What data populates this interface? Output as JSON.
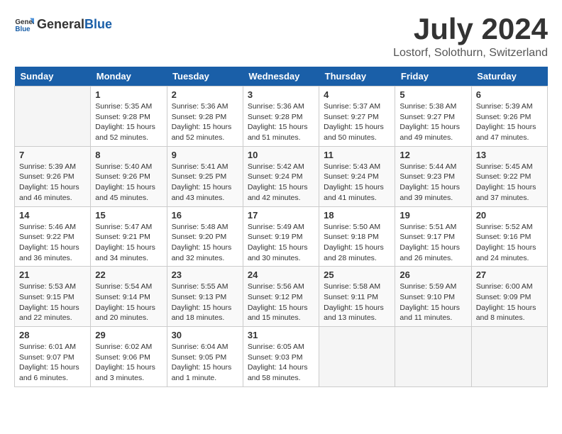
{
  "header": {
    "logo_general": "General",
    "logo_blue": "Blue",
    "month_title": "July 2024",
    "location": "Lostorf, Solothurn, Switzerland"
  },
  "weekdays": [
    "Sunday",
    "Monday",
    "Tuesday",
    "Wednesday",
    "Thursday",
    "Friday",
    "Saturday"
  ],
  "weeks": [
    [
      {
        "day": "",
        "sunrise": "",
        "sunset": "",
        "daylight": ""
      },
      {
        "day": "1",
        "sunrise": "Sunrise: 5:35 AM",
        "sunset": "Sunset: 9:28 PM",
        "daylight": "Daylight: 15 hours and 52 minutes."
      },
      {
        "day": "2",
        "sunrise": "Sunrise: 5:36 AM",
        "sunset": "Sunset: 9:28 PM",
        "daylight": "Daylight: 15 hours and 52 minutes."
      },
      {
        "day": "3",
        "sunrise": "Sunrise: 5:36 AM",
        "sunset": "Sunset: 9:28 PM",
        "daylight": "Daylight: 15 hours and 51 minutes."
      },
      {
        "day": "4",
        "sunrise": "Sunrise: 5:37 AM",
        "sunset": "Sunset: 9:27 PM",
        "daylight": "Daylight: 15 hours and 50 minutes."
      },
      {
        "day": "5",
        "sunrise": "Sunrise: 5:38 AM",
        "sunset": "Sunset: 9:27 PM",
        "daylight": "Daylight: 15 hours and 49 minutes."
      },
      {
        "day": "6",
        "sunrise": "Sunrise: 5:39 AM",
        "sunset": "Sunset: 9:26 PM",
        "daylight": "Daylight: 15 hours and 47 minutes."
      }
    ],
    [
      {
        "day": "7",
        "sunrise": "Sunrise: 5:39 AM",
        "sunset": "Sunset: 9:26 PM",
        "daylight": "Daylight: 15 hours and 46 minutes."
      },
      {
        "day": "8",
        "sunrise": "Sunrise: 5:40 AM",
        "sunset": "Sunset: 9:26 PM",
        "daylight": "Daylight: 15 hours and 45 minutes."
      },
      {
        "day": "9",
        "sunrise": "Sunrise: 5:41 AM",
        "sunset": "Sunset: 9:25 PM",
        "daylight": "Daylight: 15 hours and 43 minutes."
      },
      {
        "day": "10",
        "sunrise": "Sunrise: 5:42 AM",
        "sunset": "Sunset: 9:24 PM",
        "daylight": "Daylight: 15 hours and 42 minutes."
      },
      {
        "day": "11",
        "sunrise": "Sunrise: 5:43 AM",
        "sunset": "Sunset: 9:24 PM",
        "daylight": "Daylight: 15 hours and 41 minutes."
      },
      {
        "day": "12",
        "sunrise": "Sunrise: 5:44 AM",
        "sunset": "Sunset: 9:23 PM",
        "daylight": "Daylight: 15 hours and 39 minutes."
      },
      {
        "day": "13",
        "sunrise": "Sunrise: 5:45 AM",
        "sunset": "Sunset: 9:22 PM",
        "daylight": "Daylight: 15 hours and 37 minutes."
      }
    ],
    [
      {
        "day": "14",
        "sunrise": "Sunrise: 5:46 AM",
        "sunset": "Sunset: 9:22 PM",
        "daylight": "Daylight: 15 hours and 36 minutes."
      },
      {
        "day": "15",
        "sunrise": "Sunrise: 5:47 AM",
        "sunset": "Sunset: 9:21 PM",
        "daylight": "Daylight: 15 hours and 34 minutes."
      },
      {
        "day": "16",
        "sunrise": "Sunrise: 5:48 AM",
        "sunset": "Sunset: 9:20 PM",
        "daylight": "Daylight: 15 hours and 32 minutes."
      },
      {
        "day": "17",
        "sunrise": "Sunrise: 5:49 AM",
        "sunset": "Sunset: 9:19 PM",
        "daylight": "Daylight: 15 hours and 30 minutes."
      },
      {
        "day": "18",
        "sunrise": "Sunrise: 5:50 AM",
        "sunset": "Sunset: 9:18 PM",
        "daylight": "Daylight: 15 hours and 28 minutes."
      },
      {
        "day": "19",
        "sunrise": "Sunrise: 5:51 AM",
        "sunset": "Sunset: 9:17 PM",
        "daylight": "Daylight: 15 hours and 26 minutes."
      },
      {
        "day": "20",
        "sunrise": "Sunrise: 5:52 AM",
        "sunset": "Sunset: 9:16 PM",
        "daylight": "Daylight: 15 hours and 24 minutes."
      }
    ],
    [
      {
        "day": "21",
        "sunrise": "Sunrise: 5:53 AM",
        "sunset": "Sunset: 9:15 PM",
        "daylight": "Daylight: 15 hours and 22 minutes."
      },
      {
        "day": "22",
        "sunrise": "Sunrise: 5:54 AM",
        "sunset": "Sunset: 9:14 PM",
        "daylight": "Daylight: 15 hours and 20 minutes."
      },
      {
        "day": "23",
        "sunrise": "Sunrise: 5:55 AM",
        "sunset": "Sunset: 9:13 PM",
        "daylight": "Daylight: 15 hours and 18 minutes."
      },
      {
        "day": "24",
        "sunrise": "Sunrise: 5:56 AM",
        "sunset": "Sunset: 9:12 PM",
        "daylight": "Daylight: 15 hours and 15 minutes."
      },
      {
        "day": "25",
        "sunrise": "Sunrise: 5:58 AM",
        "sunset": "Sunset: 9:11 PM",
        "daylight": "Daylight: 15 hours and 13 minutes."
      },
      {
        "day": "26",
        "sunrise": "Sunrise: 5:59 AM",
        "sunset": "Sunset: 9:10 PM",
        "daylight": "Daylight: 15 hours and 11 minutes."
      },
      {
        "day": "27",
        "sunrise": "Sunrise: 6:00 AM",
        "sunset": "Sunset: 9:09 PM",
        "daylight": "Daylight: 15 hours and 8 minutes."
      }
    ],
    [
      {
        "day": "28",
        "sunrise": "Sunrise: 6:01 AM",
        "sunset": "Sunset: 9:07 PM",
        "daylight": "Daylight: 15 hours and 6 minutes."
      },
      {
        "day": "29",
        "sunrise": "Sunrise: 6:02 AM",
        "sunset": "Sunset: 9:06 PM",
        "daylight": "Daylight: 15 hours and 3 minutes."
      },
      {
        "day": "30",
        "sunrise": "Sunrise: 6:04 AM",
        "sunset": "Sunset: 9:05 PM",
        "daylight": "Daylight: 15 hours and 1 minute."
      },
      {
        "day": "31",
        "sunrise": "Sunrise: 6:05 AM",
        "sunset": "Sunset: 9:03 PM",
        "daylight": "Daylight: 14 hours and 58 minutes."
      },
      {
        "day": "",
        "sunrise": "",
        "sunset": "",
        "daylight": ""
      },
      {
        "day": "",
        "sunrise": "",
        "sunset": "",
        "daylight": ""
      },
      {
        "day": "",
        "sunrise": "",
        "sunset": "",
        "daylight": ""
      }
    ]
  ]
}
